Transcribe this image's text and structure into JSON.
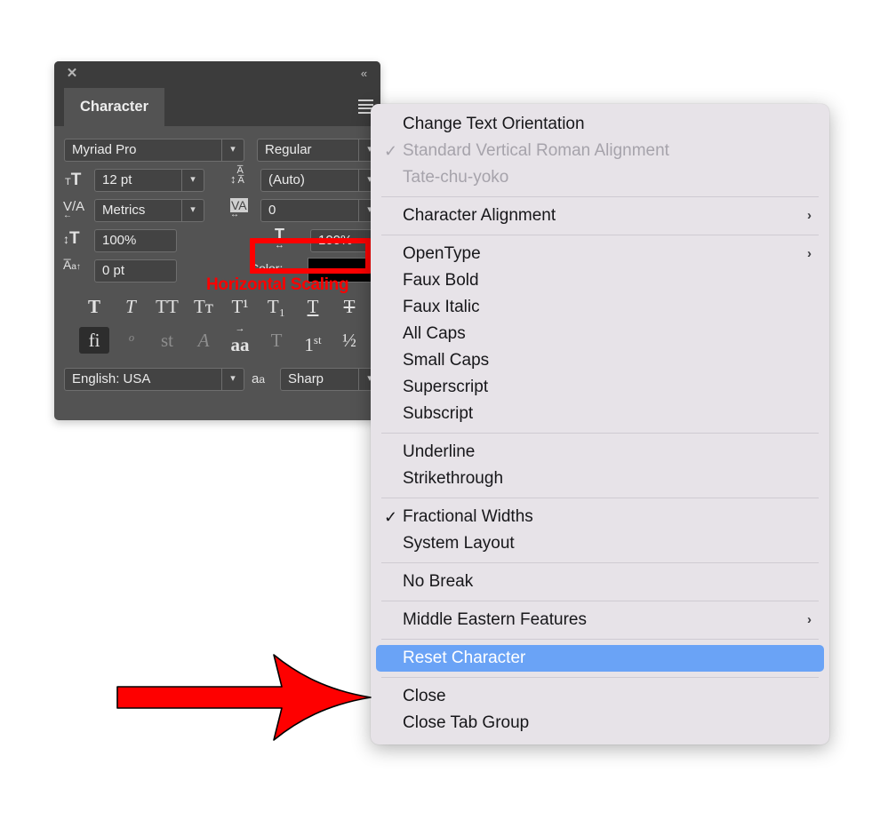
{
  "panel": {
    "title": "Character",
    "close_icon": "✕",
    "collapse_icon": "«",
    "font_family": {
      "label": "font-family-field",
      "value": "Myriad Pro"
    },
    "font_style": {
      "value": "Regular"
    },
    "font_size": {
      "icon": "TT",
      "value": "12 pt"
    },
    "leading": {
      "icon": "A/A",
      "value": "(Auto)"
    },
    "kerning": {
      "icon": "V/A",
      "value": "Metrics"
    },
    "tracking": {
      "icon": "VA",
      "value": "0"
    },
    "vertical_scale": {
      "icon": "T",
      "value": "100%"
    },
    "horizontal_scale": {
      "icon": "T",
      "value": "100%"
    },
    "baseline_shift": {
      "icon": "Aa",
      "value": "0 pt"
    },
    "color": {
      "label": "Color:",
      "swatch": "#000000"
    },
    "language": {
      "value": "English: USA"
    },
    "antialias": {
      "icon": "aa",
      "value": "Sharp"
    },
    "style_row_1": [
      {
        "name": "faux-bold",
        "glyph": "T",
        "state": "normal"
      },
      {
        "name": "faux-italic",
        "glyph": "T",
        "state": "normal"
      },
      {
        "name": "all-caps",
        "glyph": "TT",
        "state": "normal"
      },
      {
        "name": "small-caps",
        "glyph": "Tᴛ",
        "state": "normal"
      },
      {
        "name": "superscript",
        "glyph": "T¹",
        "state": "normal"
      },
      {
        "name": "subscript",
        "glyph": "T₁",
        "state": "normal"
      },
      {
        "name": "underline",
        "glyph": "T",
        "state": "normal"
      },
      {
        "name": "strikethrough",
        "glyph": "T",
        "state": "normal"
      }
    ],
    "style_row_2": [
      {
        "name": "standard-ligatures",
        "glyph": "fi",
        "state": "on"
      },
      {
        "name": "contextual-alternates",
        "glyph": "ᵒ",
        "state": "dim"
      },
      {
        "name": "discretionary-ligatures",
        "glyph": "st",
        "state": "dim"
      },
      {
        "name": "swash",
        "glyph": "A",
        "state": "dim"
      },
      {
        "name": "stylistic-alternates",
        "glyph": "aa",
        "state": "normal"
      },
      {
        "name": "titling-alternates",
        "glyph": "T",
        "state": "dim"
      },
      {
        "name": "ordinals",
        "glyph": "1st",
        "state": "normal"
      },
      {
        "name": "fractions",
        "glyph": "½",
        "state": "normal"
      }
    ]
  },
  "annotations": {
    "horizontal_scaling_label": "Horizontal Scaling",
    "accent_color": "#fe0000",
    "arrow_name": "red-pointer-arrow"
  },
  "menu": {
    "highlight_color": "#6aa3f6",
    "background_color": "#e7e3e8",
    "groups": [
      {
        "items": [
          {
            "label": "Change Text Orientation",
            "checked": false,
            "disabled": false,
            "submenu": false,
            "selected": false
          },
          {
            "label": "Standard Vertical Roman Alignment",
            "checked": true,
            "disabled": true,
            "submenu": false,
            "selected": false
          },
          {
            "label": "Tate-chu-yoko",
            "checked": false,
            "disabled": true,
            "submenu": false,
            "selected": false
          }
        ]
      },
      {
        "items": [
          {
            "label": "Character Alignment",
            "checked": false,
            "disabled": false,
            "submenu": true,
            "selected": false
          }
        ]
      },
      {
        "items": [
          {
            "label": "OpenType",
            "checked": false,
            "disabled": false,
            "submenu": true,
            "selected": false
          },
          {
            "label": "Faux Bold",
            "checked": false,
            "disabled": false,
            "submenu": false,
            "selected": false
          },
          {
            "label": "Faux Italic",
            "checked": false,
            "disabled": false,
            "submenu": false,
            "selected": false
          },
          {
            "label": "All Caps",
            "checked": false,
            "disabled": false,
            "submenu": false,
            "selected": false
          },
          {
            "label": "Small Caps",
            "checked": false,
            "disabled": false,
            "submenu": false,
            "selected": false
          },
          {
            "label": "Superscript",
            "checked": false,
            "disabled": false,
            "submenu": false,
            "selected": false
          },
          {
            "label": "Subscript",
            "checked": false,
            "disabled": false,
            "submenu": false,
            "selected": false
          }
        ]
      },
      {
        "items": [
          {
            "label": "Underline",
            "checked": false,
            "disabled": false,
            "submenu": false,
            "selected": false
          },
          {
            "label": "Strikethrough",
            "checked": false,
            "disabled": false,
            "submenu": false,
            "selected": false
          }
        ]
      },
      {
        "items": [
          {
            "label": "Fractional Widths",
            "checked": true,
            "disabled": false,
            "submenu": false,
            "selected": false
          },
          {
            "label": "System Layout",
            "checked": false,
            "disabled": false,
            "submenu": false,
            "selected": false
          }
        ]
      },
      {
        "items": [
          {
            "label": "No Break",
            "checked": false,
            "disabled": false,
            "submenu": false,
            "selected": false
          }
        ]
      },
      {
        "items": [
          {
            "label": "Middle Eastern Features",
            "checked": false,
            "disabled": false,
            "submenu": true,
            "selected": false
          }
        ]
      },
      {
        "items": [
          {
            "label": "Reset Character",
            "checked": false,
            "disabled": false,
            "submenu": false,
            "selected": true
          }
        ]
      },
      {
        "items": [
          {
            "label": "Close",
            "checked": false,
            "disabled": false,
            "submenu": false,
            "selected": false
          },
          {
            "label": "Close Tab Group",
            "checked": false,
            "disabled": false,
            "submenu": false,
            "selected": false
          }
        ]
      }
    ]
  }
}
